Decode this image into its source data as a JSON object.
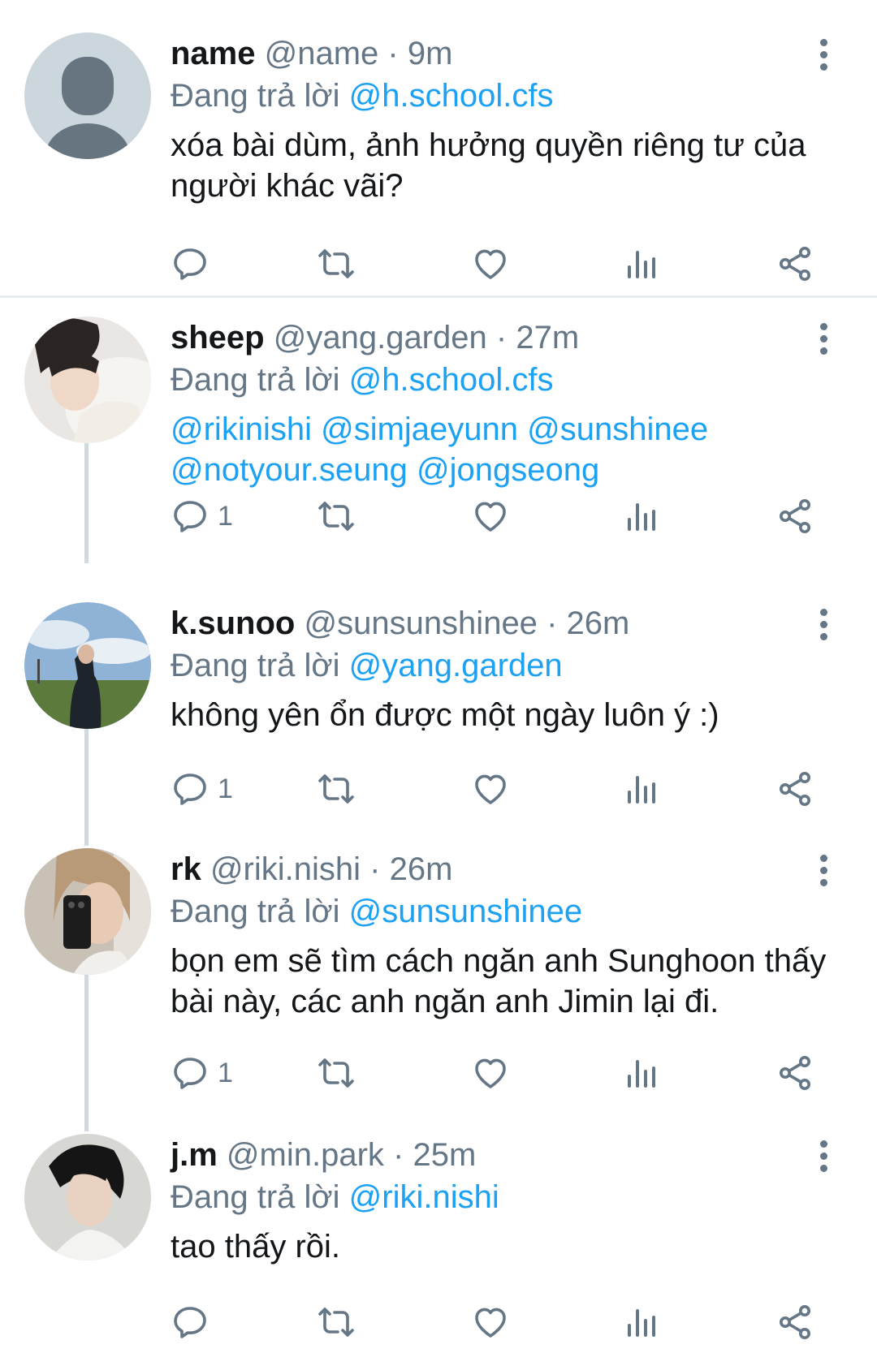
{
  "colors": {
    "link": "#1da1f2",
    "muted": "#657786",
    "text": "#14171a",
    "thread_line": "#cfd9de"
  },
  "tweets": [
    {
      "name": "name",
      "handle": "@name",
      "time": "9m",
      "reply_prefix": "Đang trả lời",
      "reply_to": "@h.school.cfs",
      "text": "xóa bài dùm, ảnh hưởng quyền riêng tư của người khác vãi?",
      "reply_count": "",
      "avatar": "default-avatar"
    },
    {
      "name": "sheep",
      "handle": "@yang.garden",
      "time": "27m",
      "reply_prefix": "Đang trả lời",
      "reply_to": "@h.school.cfs",
      "mentions": [
        "@rikinishi",
        "@simjaeyunn",
        "@sunshinee",
        "@notyour.seung",
        "@jongseong"
      ],
      "reply_count": "1",
      "avatar": "photo-avatar"
    },
    {
      "name": "k.sunoo",
      "handle": "@sunsunshinee",
      "time": "26m",
      "reply_prefix": "Đang trả lời",
      "reply_to": "@yang.garden",
      "text": "không yên ổn được một ngày luôn ý :)",
      "reply_count": "1",
      "avatar": "photo-avatar"
    },
    {
      "name": "rk",
      "handle": "@riki.nishi",
      "time": "26m",
      "reply_prefix": "Đang trả lời",
      "reply_to": "@sunsunshinee",
      "text": "bọn em sẽ tìm cách ngăn anh Sunghoon thấy bài này, các anh ngăn anh Jimin lại đi.",
      "reply_count": "1",
      "avatar": "photo-avatar"
    },
    {
      "name": "j.m",
      "handle": "@min.park",
      "time": "25m",
      "reply_prefix": "Đang trả lời",
      "reply_to": "@riki.nishi",
      "text": "tao thấy rồi.",
      "reply_count": "",
      "avatar": "photo-avatar"
    }
  ]
}
